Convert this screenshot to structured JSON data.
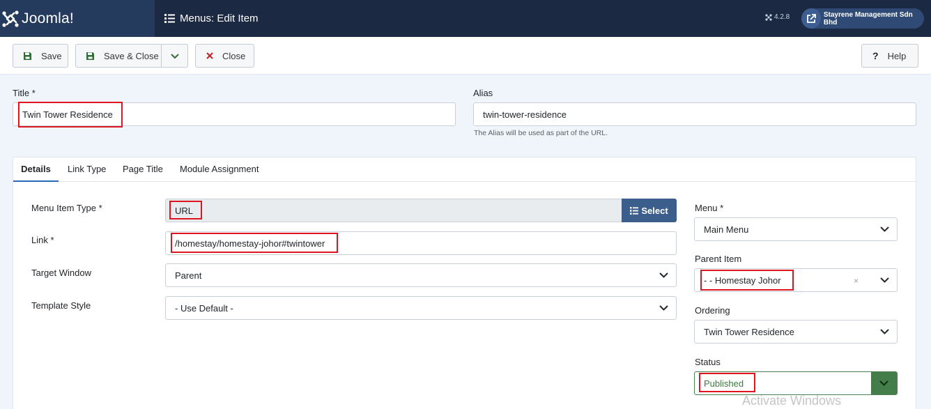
{
  "header": {
    "logo_text": "Joomla!",
    "page_title": "Menus: Edit Item",
    "version": "4.2.8",
    "site_name": "Stayrene Management Sdn Bhd"
  },
  "toolbar": {
    "save_label": "Save",
    "save_close_label": "Save & Close",
    "close_label": "Close",
    "help_label": "Help"
  },
  "form": {
    "title_label": "Title *",
    "title_value": "Twin Tower Residence",
    "alias_label": "Alias",
    "alias_value": "twin-tower-residence",
    "alias_hint": "The Alias will be used as part of the URL."
  },
  "tabs": [
    {
      "label": "Details",
      "active": true
    },
    {
      "label": "Link Type",
      "active": false
    },
    {
      "label": "Page Title",
      "active": false
    },
    {
      "label": "Module Assignment",
      "active": false
    }
  ],
  "details": {
    "menu_item_type_label": "Menu Item Type *",
    "menu_item_type_value": "URL",
    "select_label": "Select",
    "link_label": "Link *",
    "link_value": "/homestay/homestay-johor#twintower",
    "target_window_label": "Target Window",
    "target_window_value": "Parent",
    "template_style_label": "Template Style",
    "template_style_value": "- Use Default -"
  },
  "sidebar": {
    "menu_label": "Menu *",
    "menu_value": "Main Menu",
    "parent_label": "Parent Item",
    "parent_value": "- - Homestay Johor",
    "parent_clear": "×",
    "ordering_label": "Ordering",
    "ordering_value": "Twin Tower Residence",
    "status_label": "Status",
    "status_value": "Published"
  },
  "colors": {
    "header_bg": "#1c2942",
    "accent_blue": "#3c5e8c",
    "published_green": "#457d4a",
    "highlight_red": "#e0141e"
  },
  "overlay": {
    "watermark": "Activate Windows"
  }
}
